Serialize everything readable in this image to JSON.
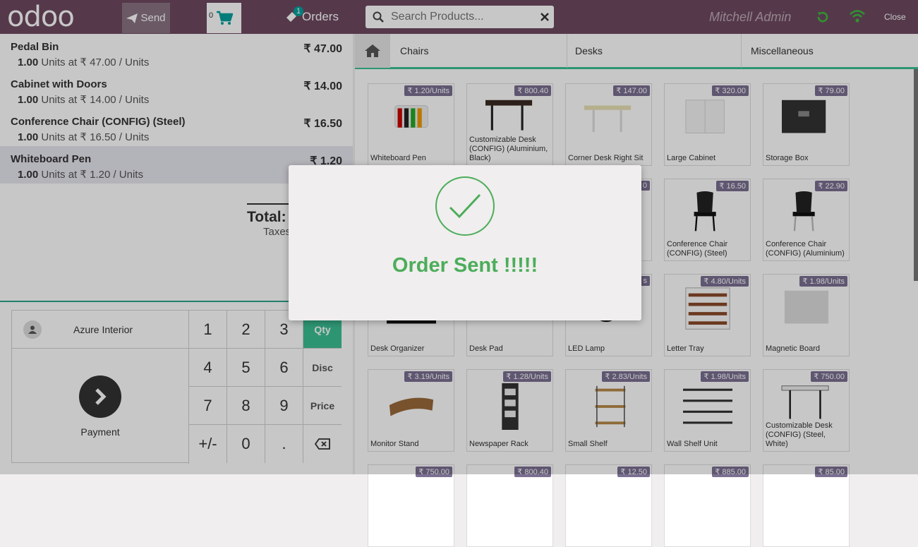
{
  "header": {
    "logo": "odoo",
    "send_label": "Send",
    "cart_count": "0",
    "orders_label": "Orders",
    "orders_badge": "1",
    "search_placeholder": "Search Products...",
    "user": "Mitchell Admin",
    "close_label": "Close"
  },
  "order_lines": [
    {
      "name": "Pedal Bin",
      "price": "₹ 47.00",
      "qty": "1.00",
      "info": "Units at ₹ 47.00 / Units"
    },
    {
      "name": "Cabinet with Doors",
      "price": "₹ 14.00",
      "qty": "1.00",
      "info": "Units at ₹ 14.00 / Units"
    },
    {
      "name": "Conference Chair (CONFIG) (Steel)",
      "price": "₹ 16.50",
      "qty": "1.00",
      "info": "Units at ₹ 16.50 / Units"
    },
    {
      "name": "Whiteboard Pen",
      "price": "₹ 1.20",
      "qty": "1.00",
      "info": "Units at ₹ 1.20 / Units"
    }
  ],
  "summary": {
    "total_label": "Total:",
    "taxes_label": "Taxes"
  },
  "numpad": {
    "customer": "Azure Interior",
    "payment": "Payment",
    "keys": [
      "1",
      "2",
      "3",
      "4",
      "5",
      "6",
      "7",
      "8",
      "9",
      "+/-",
      "0",
      "."
    ],
    "modes": [
      "Qty",
      "Disc",
      "Price"
    ]
  },
  "categories": [
    "Chairs",
    "Desks",
    "Miscellaneous"
  ],
  "products": [
    {
      "name": "Whiteboard Pen",
      "price": "₹ 1.20/Units"
    },
    {
      "name": "Customizable Desk (CONFIG) (Aluminium, Black)",
      "price": "₹ 800.40"
    },
    {
      "name": "Corner Desk Right Sit",
      "price": "₹ 147.00"
    },
    {
      "name": "Large Cabinet",
      "price": "₹ 320.00"
    },
    {
      "name": "Storage Box",
      "price": "₹ 79.00"
    },
    {
      "name": "",
      "price": ""
    },
    {
      "name": "",
      "price": ""
    },
    {
      "name": "",
      "price": "0"
    },
    {
      "name": "Conference Chair (CONFIG) (Steel)",
      "price": "₹ 16.50"
    },
    {
      "name": "Conference Chair (CONFIG) (Aluminium)",
      "price": "₹ 22.90"
    },
    {
      "name": "Desk Organizer",
      "price": ""
    },
    {
      "name": "Desk Pad",
      "price": ""
    },
    {
      "name": "LED Lamp",
      "price": "s"
    },
    {
      "name": "Letter Tray",
      "price": "₹ 4.80/Units"
    },
    {
      "name": "Magnetic Board",
      "price": "₹ 1.98/Units"
    },
    {
      "name": "Monitor Stand",
      "price": "₹ 3.19/Units"
    },
    {
      "name": "Newspaper Rack",
      "price": "₹ 1.28/Units"
    },
    {
      "name": "Small Shelf",
      "price": "₹ 2.83/Units"
    },
    {
      "name": "Wall Shelf Unit",
      "price": "₹ 1.98/Units"
    },
    {
      "name": "Customizable Desk (CONFIG) (Steel, White)",
      "price": "₹ 750.00"
    },
    {
      "name": "",
      "price": "₹ 750.00"
    },
    {
      "name": "",
      "price": "₹ 800.40"
    },
    {
      "name": "",
      "price": "₹ 12.50"
    },
    {
      "name": "",
      "price": "₹ 885.00"
    },
    {
      "name": "",
      "price": "₹ 85.00"
    }
  ],
  "modal": {
    "message": "Order Sent !!!!!"
  },
  "colors": {
    "topbar": "#6d4a61",
    "accent": "#3bbf94",
    "success": "#4cad5a",
    "price_tag": "#7a6f91"
  }
}
